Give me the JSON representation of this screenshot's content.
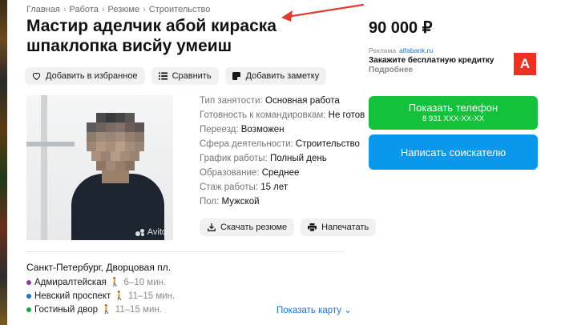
{
  "breadcrumb": [
    "Главная",
    "Работа",
    "Резюме",
    "Строительство"
  ],
  "title": "Мастир аделчик абой кираска шпаклопка висйу умеиш",
  "actions": {
    "favorite": "Добавить в избранное",
    "compare": "Сравнить",
    "note": "Добавить заметку"
  },
  "photo": {
    "watermark": "Avito"
  },
  "details": [
    {
      "key": "Тип занятости:",
      "value": "Основная работа"
    },
    {
      "key": "Готовность к командировкам:",
      "value": "Не готов"
    },
    {
      "key": "Переезд:",
      "value": "Возможен"
    },
    {
      "key": "Сфера деятельности:",
      "value": "Строительство"
    },
    {
      "key": "График работы:",
      "value": "Полный день"
    },
    {
      "key": "Образование:",
      "value": "Среднее"
    },
    {
      "key": "Стаж работы:",
      "value": "15 лет"
    },
    {
      "key": "Пол:",
      "value": "Мужской"
    }
  ],
  "doc_actions": {
    "download": "Скачать резюме",
    "print": "Напечатать"
  },
  "location": {
    "address": "Санкт-Петербург, Дворцовая пл.",
    "metro": [
      {
        "name": "Адмиралтейская",
        "time": "6–10 мин.",
        "color": "#8e3c9e"
      },
      {
        "name": "Невский проспект",
        "time": "11–15 мин.",
        "color": "#1c73c9"
      },
      {
        "name": "Гостиный двор",
        "time": "11–15 мин.",
        "color": "#1aa34a"
      }
    ],
    "show_map": "Показать карту"
  },
  "price": "90 000 ₽",
  "ad": {
    "label": "Реклама",
    "site": "alfabank.ru",
    "title": "Закажите бесплатную кредитку",
    "more": "Подробнее",
    "logo_letter": "А"
  },
  "buttons": {
    "phone": "Показать телефон",
    "phone_number": "8 931 XXX-XX-XX",
    "message": "Написать соискателю"
  },
  "colors": {
    "green": "#13c13a",
    "blue": "#0a98ec",
    "alfa_red": "#ef3124",
    "annotation_arrow": "#e03b2f"
  }
}
